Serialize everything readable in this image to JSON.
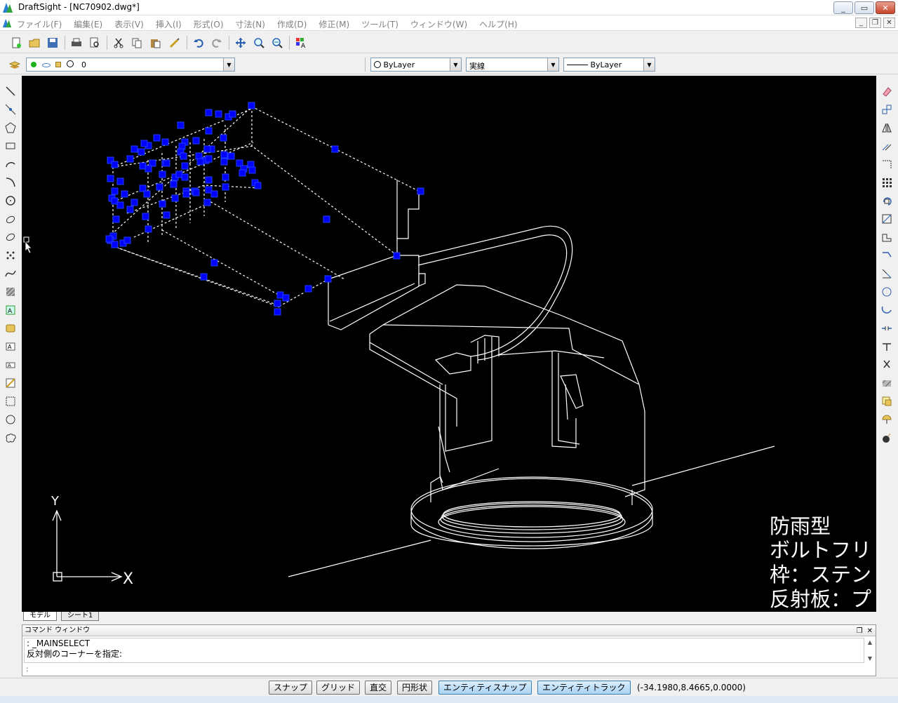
{
  "window": {
    "title": "DraftSight - [NC70902.dwg*]",
    "controls": {
      "minimize": "_",
      "restore": "▭",
      "close": "✕"
    },
    "mdi_controls": {
      "minimize": "_",
      "restore": "❐",
      "close": "✕"
    }
  },
  "menu": {
    "items": [
      "ファイル(F)",
      "編集(E)",
      "表示(V)",
      "挿入(I)",
      "形式(O)",
      "寸法(N)",
      "作成(D)",
      "修正(M)",
      "ツール(T)",
      "ウィンドウ(W)",
      "ヘルプ(H)"
    ]
  },
  "toolbar2": {
    "layer_value": "0",
    "color_value": "ByLayer",
    "linetype_value": "実線",
    "lineweight_value": "ByLayer"
  },
  "drawing": {
    "note_lines": [
      "防雨型",
      "ボルトフリ",
      "枠：ステン",
      "反射板：プ"
    ],
    "ucs_y": "Y",
    "ucs_x": "X"
  },
  "tabs": {
    "model": "モデル",
    "sheet1": "シート1"
  },
  "command_window": {
    "title": "コマンド ウィンドウ",
    "log": [
      ": _MAINSELECT",
      "反対側のコーナーを指定:"
    ],
    "prompt": ":"
  },
  "status": {
    "buttons": [
      {
        "label": "スナップ",
        "on": false
      },
      {
        "label": "グリッド",
        "on": false
      },
      {
        "label": "直交",
        "on": false
      },
      {
        "label": "円形状",
        "on": false
      },
      {
        "label": "エンティティスナップ",
        "on": true
      },
      {
        "label": "エンティティトラック",
        "on": true
      }
    ],
    "coordinates": "(-34.1980,8.4665,0.0000)"
  },
  "colors": {
    "canvas": "#000000",
    "grip": "#0000ff",
    "lines": "#ffffff"
  }
}
